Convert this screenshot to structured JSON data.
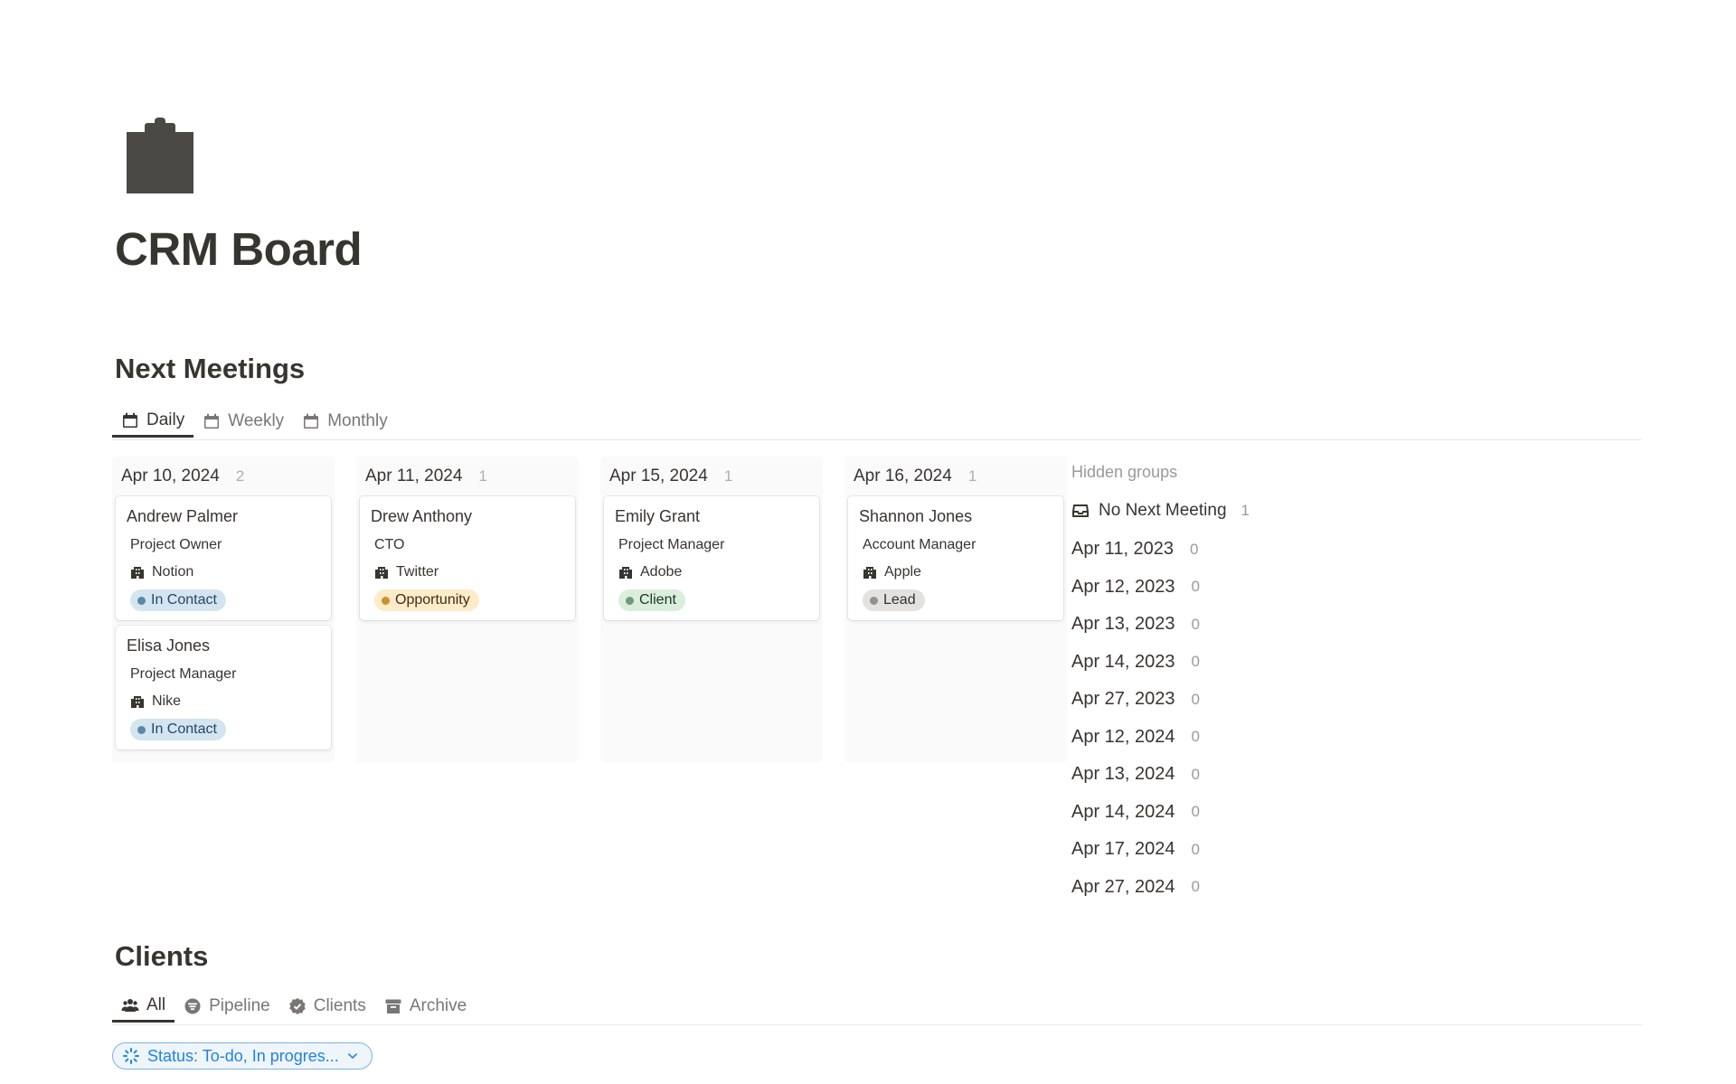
{
  "page": {
    "title": "CRM Board",
    "icon": "clipboard-icon"
  },
  "meetings": {
    "title": "Next Meetings",
    "tabs": [
      {
        "label": "Daily",
        "icon": "calendar-icon",
        "active": true
      },
      {
        "label": "Weekly",
        "icon": "calendar-icon",
        "active": false
      },
      {
        "label": "Monthly",
        "icon": "calendar-icon",
        "active": false
      }
    ],
    "columns": [
      {
        "date": "Apr 10, 2024",
        "count": "2",
        "cards": [
          {
            "name": "Andrew Palmer",
            "role": "Project Owner",
            "company": "Notion",
            "status": "In Contact"
          },
          {
            "name": "Elisa Jones",
            "role": "Project Manager",
            "company": "Nike",
            "status": "In Contact"
          }
        ]
      },
      {
        "date": "Apr 11, 2024",
        "count": "1",
        "cards": [
          {
            "name": "Drew Anthony",
            "role": "CTO",
            "company": "Twitter",
            "status": "Opportunity"
          }
        ]
      },
      {
        "date": "Apr 15, 2024",
        "count": "1",
        "cards": [
          {
            "name": "Emily Grant",
            "role": "Project Manager",
            "company": "Adobe",
            "status": "Client"
          }
        ]
      },
      {
        "date": "Apr 16, 2024",
        "count": "1",
        "cards": [
          {
            "name": "Shannon Jones",
            "role": "Account Manager",
            "company": "Apple",
            "status": "Lead"
          }
        ]
      }
    ],
    "hidden_groups": {
      "title": "Hidden groups",
      "no_meeting": {
        "label": "No Next Meeting",
        "count": "1",
        "icon": "inbox-icon"
      },
      "groups": [
        {
          "date": "Apr 11, 2023",
          "count": "0"
        },
        {
          "date": "Apr 12, 2023",
          "count": "0"
        },
        {
          "date": "Apr 13, 2023",
          "count": "0"
        },
        {
          "date": "Apr 14, 2023",
          "count": "0"
        },
        {
          "date": "Apr 27, 2023",
          "count": "0"
        },
        {
          "date": "Apr 12, 2024",
          "count": "0"
        },
        {
          "date": "Apr 13, 2024",
          "count": "0"
        },
        {
          "date": "Apr 14, 2024",
          "count": "0"
        },
        {
          "date": "Apr 17, 2024",
          "count": "0"
        },
        {
          "date": "Apr 27, 2024",
          "count": "0"
        }
      ]
    }
  },
  "status_colors": {
    "In Contact": {
      "bg": "#d3e5ef",
      "dot": "#5e87a8",
      "text": "#28456c"
    },
    "Opportunity": {
      "bg": "#fdecc8",
      "dot": "#cb912f",
      "text": "#402c1b"
    },
    "Client": {
      "bg": "#dbeddb",
      "dot": "#6c9b7d",
      "text": "#1c3829"
    },
    "Lead": {
      "bg": "#e3e2e0",
      "dot": "#91918e",
      "text": "#32302c"
    }
  },
  "clients": {
    "title": "Clients",
    "tabs": [
      {
        "label": "All",
        "icon": "people-icon",
        "active": true
      },
      {
        "label": "Pipeline",
        "icon": "pipeline-icon",
        "active": false
      },
      {
        "label": "Clients",
        "icon": "verified-icon",
        "active": false
      },
      {
        "label": "Archive",
        "icon": "archive-icon",
        "active": false
      }
    ],
    "filter": {
      "label": "Status: To-do, In progres...",
      "icon": "status-spinner-icon"
    }
  }
}
